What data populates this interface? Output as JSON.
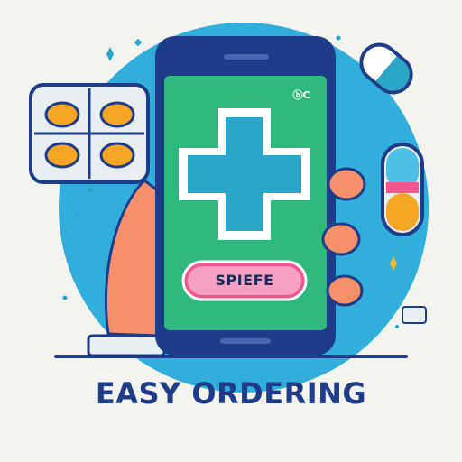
{
  "caption": "EASY ORDERING",
  "phone": {
    "status_text": "ⓑC",
    "button_label": "SPIEFE"
  },
  "colors": {
    "background": "#f3f3ef",
    "circle": "#29a8d8",
    "phone_body": "#1f3c8a",
    "screen": "#2fb87e",
    "cross_fill": "#2aa6c9",
    "button": "#f2568f",
    "caption": "#1f3c8a",
    "skin": "#f6906b"
  },
  "icons": [
    "plus-cross-icon",
    "capsule-icon",
    "blister-pack-icon",
    "sparkle-icon",
    "hand-icon",
    "pill-icon"
  ]
}
